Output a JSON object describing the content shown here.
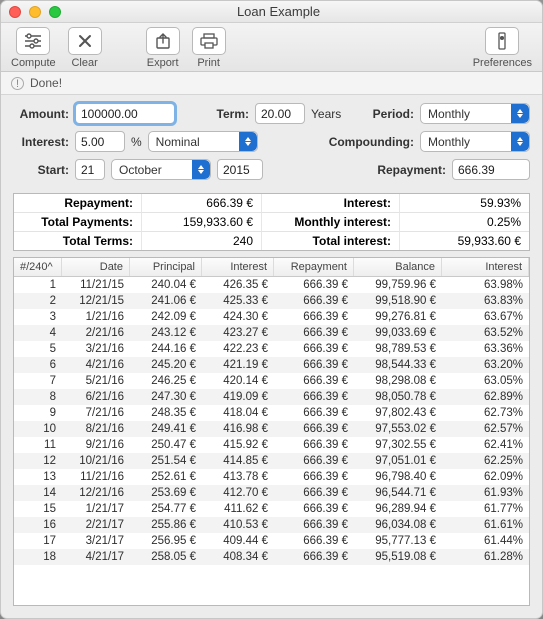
{
  "window": {
    "title": "Loan Example"
  },
  "toolbar": {
    "compute": "Compute",
    "clear": "Clear",
    "export": "Export",
    "print": "Print",
    "preferences": "Preferences"
  },
  "status": {
    "message": "Done!"
  },
  "form": {
    "amount_label": "Amount:",
    "amount_value": "100000.00",
    "term_label": "Term:",
    "term_value": "20.00",
    "term_unit": "Years",
    "period_label": "Period:",
    "period_value": "Monthly",
    "interest_label": "Interest:",
    "interest_value": "5.00",
    "interest_unit": "%",
    "interest_type": "Nominal",
    "compounding_label": "Compounding:",
    "compounding_value": "Monthly",
    "start_label": "Start:",
    "start_day": "21",
    "start_month": "October",
    "start_year": "2015",
    "repayment_label": "Repayment:",
    "repayment_value": "666.39"
  },
  "summary": {
    "rows": [
      {
        "l1": "Repayment:",
        "v1": "666.39 €",
        "l2": "Interest:",
        "v2": "59.93%"
      },
      {
        "l1": "Total Payments:",
        "v1": "159,933.60 €",
        "l2": "Monthly interest:",
        "v2": "0.25%"
      },
      {
        "l1": "Total Terms:",
        "v1": "240",
        "l2": "Total interest:",
        "v2": "59,933.60 €"
      }
    ]
  },
  "schedule": {
    "headers": [
      "#/240^",
      "Date",
      "Principal",
      "Interest",
      "Repayment",
      "Balance",
      "Interest"
    ],
    "rows": [
      {
        "n": "1",
        "date": "11/21/15",
        "principal": "240.04 €",
        "interest": "426.35 €",
        "repayment": "666.39 €",
        "balance": "99,759.96 €",
        "rate": "63.98%"
      },
      {
        "n": "2",
        "date": "12/21/15",
        "principal": "241.06 €",
        "interest": "425.33 €",
        "repayment": "666.39 €",
        "balance": "99,518.90 €",
        "rate": "63.83%"
      },
      {
        "n": "3",
        "date": "1/21/16",
        "principal": "242.09 €",
        "interest": "424.30 €",
        "repayment": "666.39 €",
        "balance": "99,276.81 €",
        "rate": "63.67%"
      },
      {
        "n": "4",
        "date": "2/21/16",
        "principal": "243.12 €",
        "interest": "423.27 €",
        "repayment": "666.39 €",
        "balance": "99,033.69 €",
        "rate": "63.52%"
      },
      {
        "n": "5",
        "date": "3/21/16",
        "principal": "244.16 €",
        "interest": "422.23 €",
        "repayment": "666.39 €",
        "balance": "98,789.53 €",
        "rate": "63.36%"
      },
      {
        "n": "6",
        "date": "4/21/16",
        "principal": "245.20 €",
        "interest": "421.19 €",
        "repayment": "666.39 €",
        "balance": "98,544.33 €",
        "rate": "63.20%"
      },
      {
        "n": "7",
        "date": "5/21/16",
        "principal": "246.25 €",
        "interest": "420.14 €",
        "repayment": "666.39 €",
        "balance": "98,298.08 €",
        "rate": "63.05%"
      },
      {
        "n": "8",
        "date": "6/21/16",
        "principal": "247.30 €",
        "interest": "419.09 €",
        "repayment": "666.39 €",
        "balance": "98,050.78 €",
        "rate": "62.89%"
      },
      {
        "n": "9",
        "date": "7/21/16",
        "principal": "248.35 €",
        "interest": "418.04 €",
        "repayment": "666.39 €",
        "balance": "97,802.43 €",
        "rate": "62.73%"
      },
      {
        "n": "10",
        "date": "8/21/16",
        "principal": "249.41 €",
        "interest": "416.98 €",
        "repayment": "666.39 €",
        "balance": "97,553.02 €",
        "rate": "62.57%"
      },
      {
        "n": "11",
        "date": "9/21/16",
        "principal": "250.47 €",
        "interest": "415.92 €",
        "repayment": "666.39 €",
        "balance": "97,302.55 €",
        "rate": "62.41%"
      },
      {
        "n": "12",
        "date": "10/21/16",
        "principal": "251.54 €",
        "interest": "414.85 €",
        "repayment": "666.39 €",
        "balance": "97,051.01 €",
        "rate": "62.25%"
      },
      {
        "n": "13",
        "date": "11/21/16",
        "principal": "252.61 €",
        "interest": "413.78 €",
        "repayment": "666.39 €",
        "balance": "96,798.40 €",
        "rate": "62.09%"
      },
      {
        "n": "14",
        "date": "12/21/16",
        "principal": "253.69 €",
        "interest": "412.70 €",
        "repayment": "666.39 €",
        "balance": "96,544.71 €",
        "rate": "61.93%"
      },
      {
        "n": "15",
        "date": "1/21/17",
        "principal": "254.77 €",
        "interest": "411.62 €",
        "repayment": "666.39 €",
        "balance": "96,289.94 €",
        "rate": "61.77%"
      },
      {
        "n": "16",
        "date": "2/21/17",
        "principal": "255.86 €",
        "interest": "410.53 €",
        "repayment": "666.39 €",
        "balance": "96,034.08 €",
        "rate": "61.61%"
      },
      {
        "n": "17",
        "date": "3/21/17",
        "principal": "256.95 €",
        "interest": "409.44 €",
        "repayment": "666.39 €",
        "balance": "95,777.13 €",
        "rate": "61.44%"
      },
      {
        "n": "18",
        "date": "4/21/17",
        "principal": "258.05 €",
        "interest": "408.34 €",
        "repayment": "666.39 €",
        "balance": "95,519.08 €",
        "rate": "61.28%"
      }
    ]
  }
}
